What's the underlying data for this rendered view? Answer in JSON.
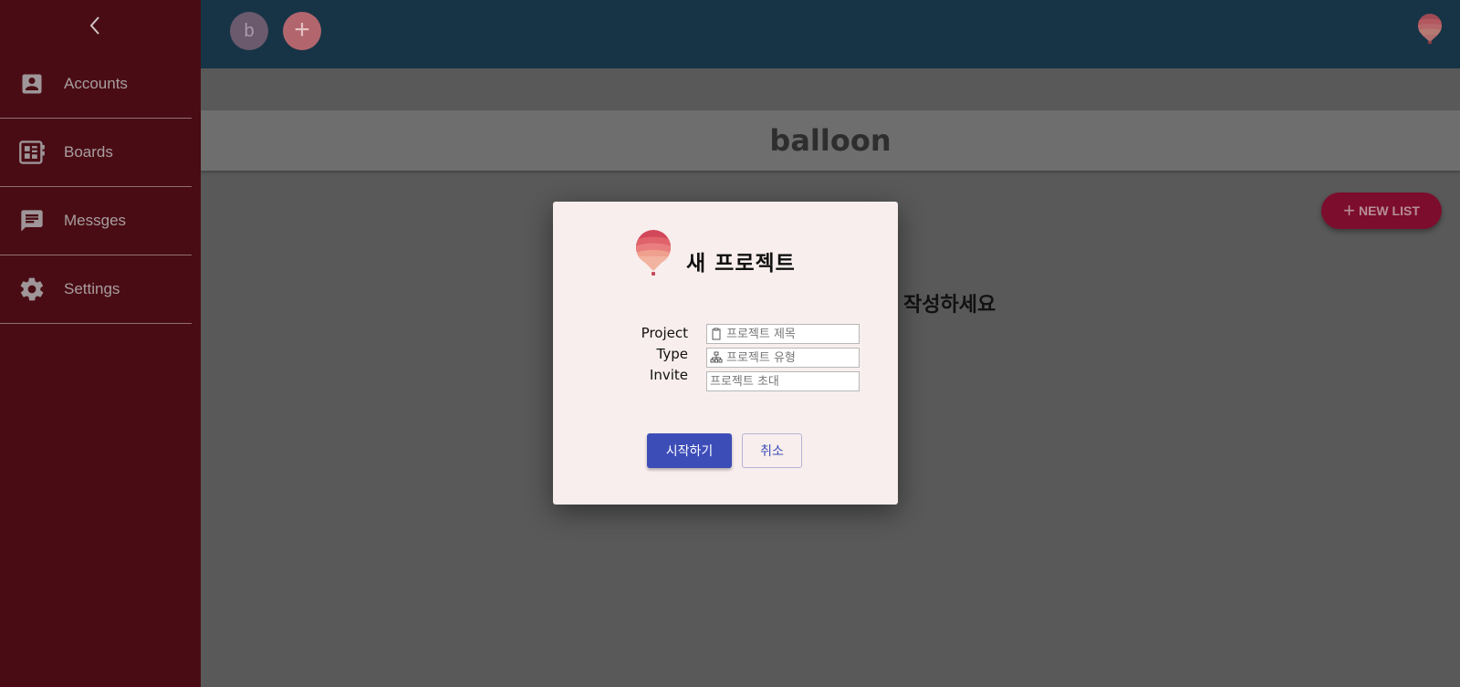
{
  "sidebar": {
    "items": [
      {
        "label": "Accounts",
        "icon": "account-box-icon"
      },
      {
        "label": "Boards",
        "icon": "dashboard-icon"
      },
      {
        "label": "Messges",
        "icon": "message-icon"
      },
      {
        "label": "Settings",
        "icon": "gear-icon"
      }
    ]
  },
  "topbar": {
    "avatar_initial": "b",
    "add_label": "+"
  },
  "board": {
    "title": "balloon",
    "new_list_label": "NEW LIST",
    "empty_message_visible": "작성하세요"
  },
  "modal": {
    "title": "새 프로젝트",
    "fields": [
      {
        "label": "Project",
        "placeholder": "프로젝트 제목",
        "icon": "clipboard-icon"
      },
      {
        "label": "Type",
        "placeholder": "프로젝트 유형",
        "icon": "sitemap-icon"
      },
      {
        "label": "Invite",
        "placeholder": "프로젝트 초대"
      }
    ],
    "start_button": "시작하기",
    "cancel_button": "취소"
  },
  "colors": {
    "sidebar_bg": "#4a0c14",
    "topbar_bg": "#173446",
    "overlay_bg": "#595959",
    "accent_pink": "#7d0d2c",
    "primary_button": "#3d4db8",
    "modal_bg": "#f8eeed"
  }
}
